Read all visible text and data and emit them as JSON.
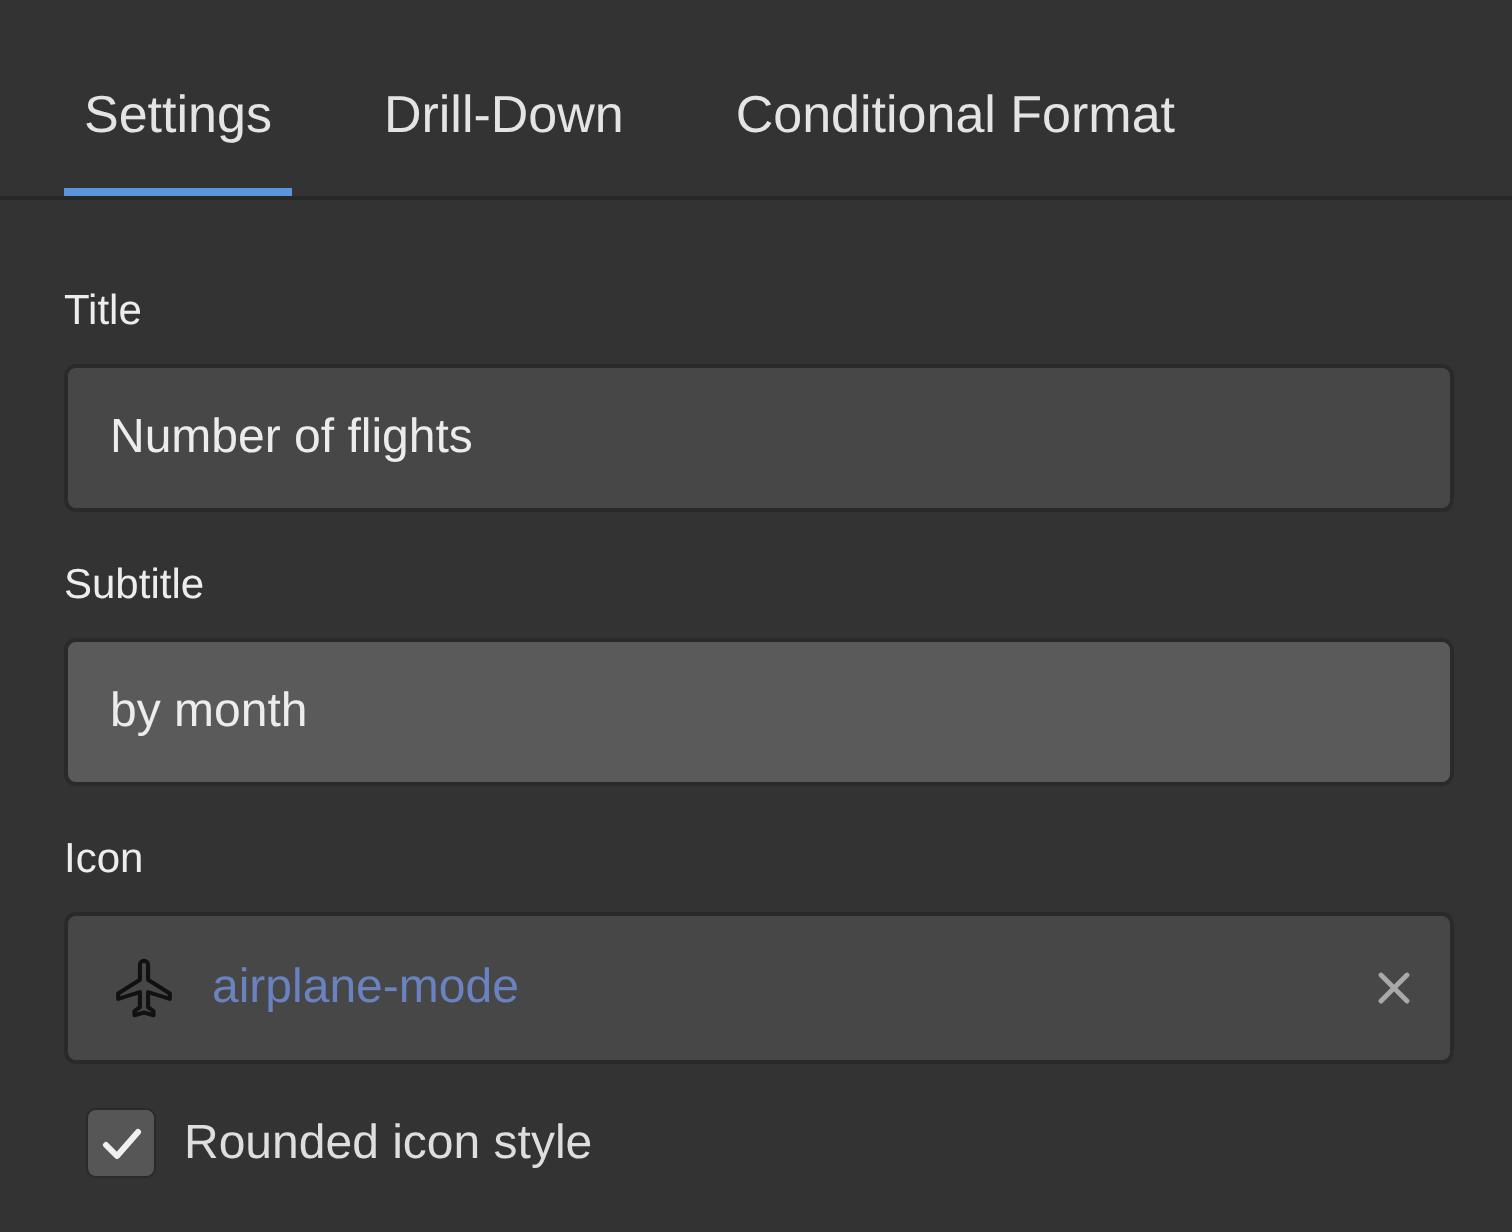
{
  "tabs": [
    {
      "label": "Settings",
      "selected": true
    },
    {
      "label": "Drill-Down",
      "selected": false
    },
    {
      "label": "Conditional Format",
      "selected": false
    }
  ],
  "fields": [
    {
      "kind": "text",
      "label": "Title",
      "value": "Number of flights",
      "hovered": false
    },
    {
      "kind": "text",
      "label": "Subtitle",
      "value": "by month",
      "hovered": true
    },
    {
      "kind": "icon",
      "label": "Icon",
      "value": "airplane-mode",
      "hovered": false
    }
  ],
  "checkbox": {
    "label": "Rounded icon style",
    "checked": true
  }
}
